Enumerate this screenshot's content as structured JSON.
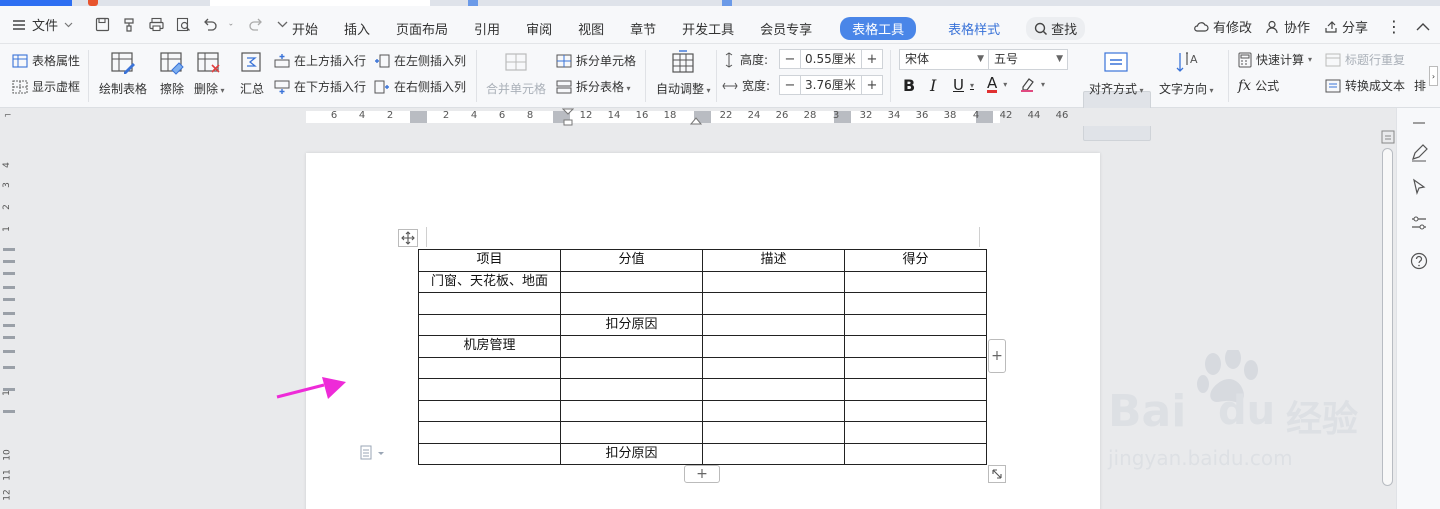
{
  "menubar": {
    "file_label": "文件",
    "tabs": [
      "开始",
      "插入",
      "页面布局",
      "引用",
      "审阅",
      "视图",
      "章节",
      "开发工具",
      "会员专享"
    ],
    "active_tab": "表格工具",
    "context_tab": "表格样式",
    "search_label": "查找",
    "right": {
      "changes": "有修改",
      "collab": "协作",
      "share": "分享"
    }
  },
  "ribbon": {
    "table_props": "表格属性",
    "show_grid": "显示虚框",
    "draw_table": "绘制表格",
    "erase": "擦除",
    "delete": "删除",
    "summary": "汇总",
    "insert_above": "在上方插入行",
    "insert_below": "在下方插入行",
    "insert_left": "在左侧插入列",
    "insert_right": "在右侧插入列",
    "merge_cells": "合并单元格",
    "split_cells": "拆分单元格",
    "split_table": "拆分表格",
    "auto_fit": "自动调整",
    "height_label": "高度:",
    "height_value": "0.55厘米",
    "width_label": "宽度:",
    "width_value": "3.76厘米",
    "font_name": "宋体",
    "font_size": "五号",
    "bold": "B",
    "italic": "I",
    "underline": "U",
    "font_color": "A",
    "align": "对齐方式",
    "text_direction": "文字方向",
    "quick_calc": "快速计算",
    "repeat_header": "标题行重复",
    "formula": "公式",
    "convert_text": "转换成文本",
    "sort_partial": "排"
  },
  "ruler": {
    "numbers": [
      "6",
      "4",
      "2",
      "2",
      "4",
      "6",
      "8",
      "12",
      "14",
      "16",
      "18",
      "22",
      "24",
      "26",
      "28",
      "3",
      "32",
      "34",
      "36",
      "38",
      "4",
      "42",
      "44",
      "46"
    ],
    "vnumbers": [
      "4",
      "3",
      "2",
      "1",
      "1",
      "10",
      "11",
      "12"
    ]
  },
  "table": {
    "rows": [
      [
        "项目",
        "分值",
        "描述",
        "得分"
      ],
      [
        "门窗、天花板、地面",
        "",
        "",
        ""
      ],
      [
        "",
        "",
        "",
        ""
      ],
      [
        "",
        "扣分原因",
        "",
        ""
      ],
      [
        "机房管理",
        "",
        "",
        ""
      ],
      [
        "",
        "",
        "",
        ""
      ],
      [
        "",
        "",
        "",
        ""
      ],
      [
        "",
        "",
        "",
        ""
      ],
      [
        "",
        "",
        "",
        ""
      ],
      [
        "",
        "扣分原因",
        "",
        ""
      ]
    ]
  },
  "watermark": {
    "brand": "Bai",
    "brand2": "du",
    "cn": "经验",
    "url": "jingyan.baidu.com"
  },
  "colors": {
    "accent": "#4a86e8",
    "arrow": "#ee2bd8",
    "brand_blue": "#2e6ff2"
  }
}
